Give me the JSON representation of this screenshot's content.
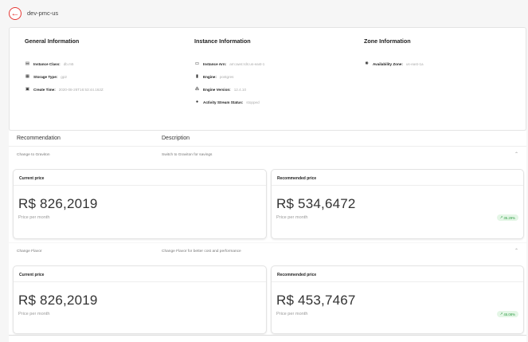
{
  "header": {
    "back_icon": "arrow-left-icon",
    "title": "dev-pmc-us"
  },
  "info": {
    "general": {
      "title": "General Information",
      "rows": [
        {
          "icon": "server-icon",
          "label": "Instance Class:",
          "value": "db.m5"
        },
        {
          "icon": "storage-icon",
          "label": "Storage Type:",
          "value": "gp2"
        },
        {
          "icon": "calendar-icon",
          "label": "Create Time:",
          "value": "2020-08-26T16:53:44.162Z"
        }
      ]
    },
    "instance": {
      "title": "Instance Information",
      "rows": [
        {
          "icon": "id-card-icon",
          "label": "Instance Arn:",
          "value": "arn:aws:rds:us-east-1"
        },
        {
          "icon": "database-icon",
          "label": "Engine:",
          "value": "postgres"
        },
        {
          "icon": "engine-icon",
          "label": "Engine Version:",
          "value": "12.4.10"
        },
        {
          "icon": "user-stream-icon",
          "label": "Activity Stream Status:",
          "value": "stopped"
        }
      ]
    },
    "zone": {
      "title": "Zone Information",
      "rows": [
        {
          "icon": "globe-icon",
          "label": "Availability Zone:",
          "value": "us-east-1a"
        }
      ]
    }
  },
  "recommendations": {
    "col_recommendation": "Recommendation",
    "col_description": "Description",
    "items": [
      {
        "name": "Change to Graviton",
        "description": "Switch to Graviton for savings",
        "current_title": "Current price",
        "current_price": "R$ 826,2019",
        "current_sub": "Price per month",
        "recommended_title": "Recommended price",
        "recommended_price": "R$ 534,6472",
        "recommended_sub": "Price per month",
        "savings": "35.29%"
      },
      {
        "name": "Change Flavor",
        "description": "Change Flavor for better cost and performance",
        "current_title": "Current price",
        "current_price": "R$ 826,2019",
        "current_sub": "Price per month",
        "recommended_title": "Recommended price",
        "recommended_price": "R$ 453,7467",
        "recommended_sub": "Price per month",
        "savings": "45.08%"
      }
    ]
  },
  "colors": {
    "accent": "#e53935",
    "success": "#2e9c44",
    "success_bg": "#e4f6e6"
  }
}
